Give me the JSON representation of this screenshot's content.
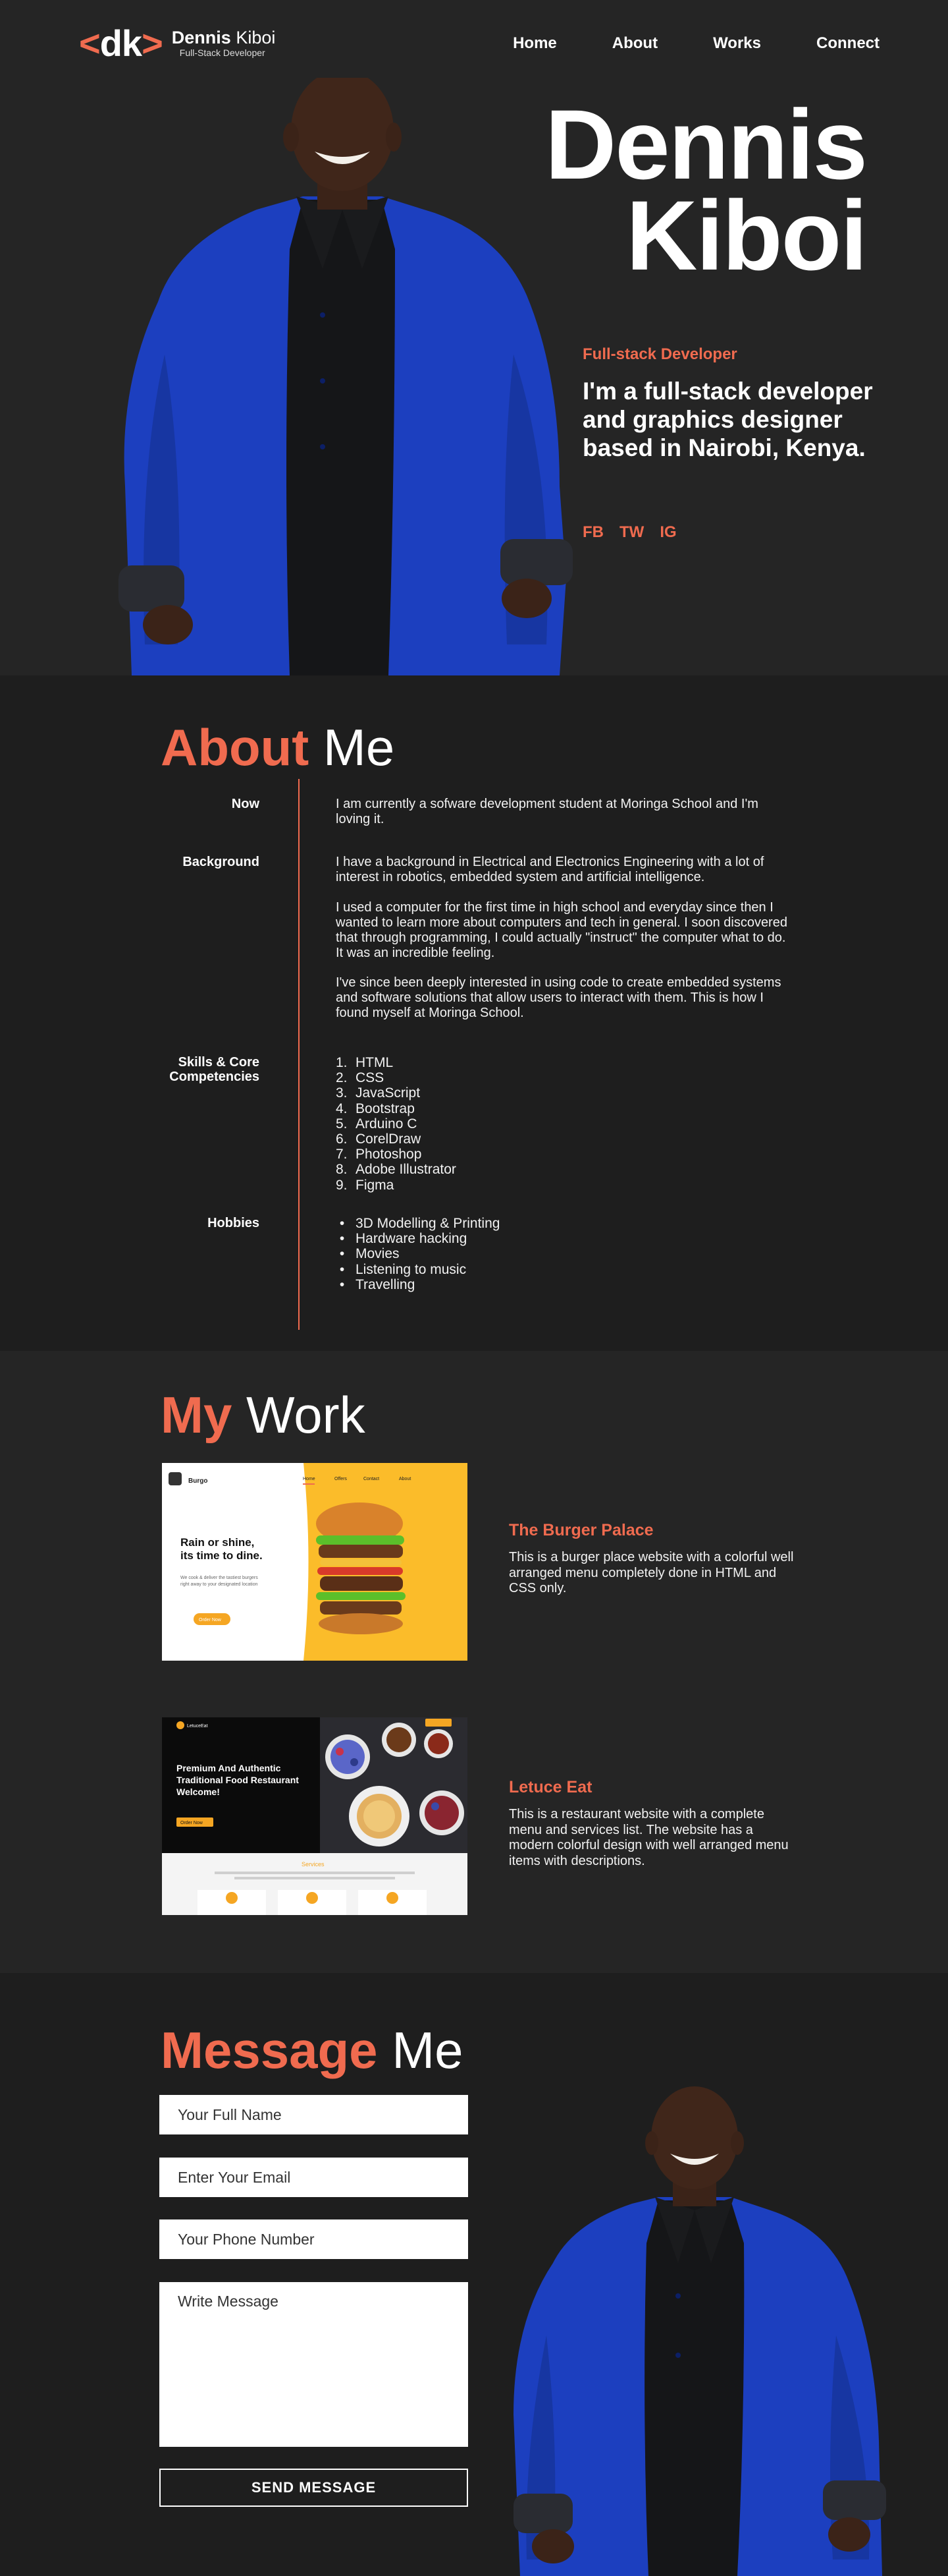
{
  "brand": {
    "logo_left": "<",
    "logo_letters": "dk",
    "logo_right": ">",
    "name_first": "Dennis",
    "name_last": "Kiboi",
    "subtitle": "Full-Stack Developer"
  },
  "nav": {
    "items": [
      {
        "label": "Home"
      },
      {
        "label": "About"
      },
      {
        "label": "Works"
      },
      {
        "label": "Connect"
      }
    ]
  },
  "hero": {
    "name_line1": "Dennis",
    "name_line2": "Kiboi",
    "role": "Full-stack Developer",
    "tagline": "I'm a full-stack developer and graphics designer based in Nairobi, Kenya.",
    "social": [
      {
        "label": "FB"
      },
      {
        "label": "TW"
      },
      {
        "label": "IG"
      }
    ]
  },
  "about": {
    "title_accent": "About",
    "title_rest": "Me",
    "now_label": "Now",
    "now_text": "I am currently a sofware development student at Moringa School and I'm loving it.",
    "background_label": "Background",
    "background_paragraphs": [
      "I have a background in Electrical and Electronics Engineering with a lot of interest in robotics, embedded system and artificial intelligence.",
      "I used a computer for the first time in high school and everyday since then I wanted to learn more about computers and tech in general. I soon discovered that through programming, I could actually \"instruct\" the computer what to do. It was an incredible feeling.",
      "I've since been deeply interested in using code to create embedded systems and software solutions that allow users to interact with them. This is how I found myself at Moringa School."
    ],
    "skills_label_line1": "Skills & Core",
    "skills_label_line2": "Competencies",
    "skills": [
      "HTML",
      "CSS",
      "JavaScript",
      "Bootstrap",
      "Arduino C",
      "CorelDraw",
      "Photoshop",
      "Adobe Illustrator",
      "Figma"
    ],
    "hobbies_label": "Hobbies",
    "hobbies": [
      "3D Modelling & Printing",
      "Hardware hacking",
      "Movies",
      "Listening to music",
      "Travelling"
    ]
  },
  "work": {
    "title_accent": "My",
    "title_rest": "Work",
    "projects": [
      {
        "name": "The Burger Palace",
        "description": "This is a burger place website with a colorful well arranged menu completely done in HTML and CSS only.",
        "thumb": {
          "logo": "Burgo",
          "nav": [
            "Home",
            "Offers",
            "Contact",
            "About"
          ],
          "headline_line1": "Rain or shine,",
          "headline_line2": "its time to dine.",
          "body_line1": "We cook & deliver the tastiest burgers",
          "body_line2": "right away to your designated location",
          "cta": "Order Now"
        }
      },
      {
        "name": "Letuce Eat",
        "description": "This is a restaurant website with a complete menu and services list. The website has a modern colorful design with well arranged menu items with descriptions.",
        "thumb": {
          "logo": "LetuceEat",
          "headline_line1": "Premium And Authentic",
          "headline_line2": "Traditional  Food Restaurant",
          "headline_line3": "Welcome!",
          "cta": "Order Now",
          "services_title": "Services"
        }
      }
    ]
  },
  "message": {
    "title_accent": "Message",
    "title_rest": "Me",
    "name_placeholder": "Your Full Name",
    "email_placeholder": "Enter Your Email",
    "phone_placeholder": "Your Phone Number",
    "message_placeholder": "Write Message",
    "send_label": "SEND MESSAGE"
  },
  "colors": {
    "accent": "#f06b4f",
    "background_dark": "#1e1e1e",
    "background_mid": "#252525",
    "jacket_blue": "#1c3fbf"
  }
}
